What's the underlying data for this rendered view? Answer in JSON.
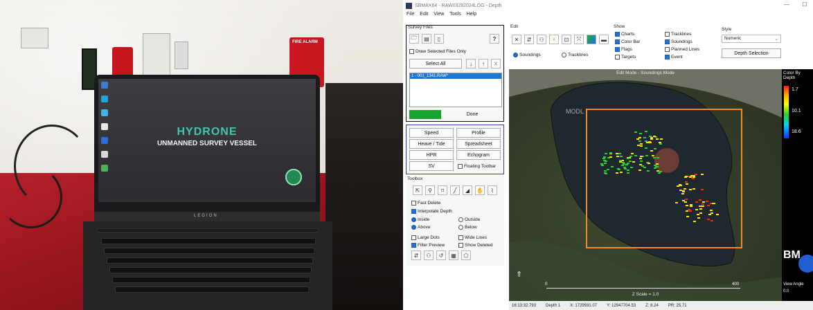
{
  "photo": {
    "screen_title": "HYDRONE",
    "screen_subtitle": "UNMANNED SURVEY VESSEL",
    "brand": "LEGION",
    "alarm_text": "FIRE ALARM"
  },
  "window": {
    "title": "SBMAX64 - RAW03282024LOG - Depth",
    "minimize": "—",
    "maximize": "☐"
  },
  "menu": [
    "File",
    "Edit",
    "View",
    "Tools",
    "Help"
  ],
  "survey_files": {
    "title": "Survey Files",
    "help": "?",
    "draw_selected_label": "Draw Selected Files Only",
    "select_all": "Select All",
    "file_item": "1 - 001_1341.RAW*",
    "done": "Done"
  },
  "modules": {
    "speed": "Speed",
    "profile": "Profile",
    "heave_tide": "Heave / Tide",
    "spreadsheet": "Spreadsheet",
    "hpr": "HPR",
    "echogram": "Echogram",
    "sv": "SV",
    "floating_toolbar": "Floating Toolbar"
  },
  "toolbox": {
    "title": "Toolbox",
    "fast_delete": "Fast Delete",
    "interpolate_depth": "Interpolate Depth",
    "inside": "Inside",
    "outside": "Outside",
    "above": "Above",
    "below": "Below",
    "large_dots": "Large Dots",
    "wide_lines": "Wide Lines",
    "filter_preview": "Filter Preview",
    "show_deleted": "Show Deleted"
  },
  "edit_group": {
    "title": "Edit",
    "soundings": "Soundings",
    "tracklines": "Tracklines"
  },
  "show_group": {
    "title": "Show",
    "charts": "Charts",
    "color_bar": "Color Bar",
    "flags": "Flags",
    "targets": "Targets",
    "tracklines": "Tracklines",
    "soundings": "Soundings",
    "planned_lines": "Planned Lines",
    "event": "Event"
  },
  "style_group": {
    "title": "Style",
    "selected": "Numeric",
    "depth_selection": "Depth Selection"
  },
  "map": {
    "mode_label": "Edit Mode - Soundings Mode",
    "z_scale": "Z Scale = 1.0",
    "scale_left": "0",
    "scale_right": "400",
    "corner_text": "BM",
    "view_angle": "View Angle",
    "view_angle_value": "0.0",
    "colors": {
      "high": "#ff2a00",
      "mid": "#ffe600",
      "low": "#2bd12b",
      "route": "#f08a2a"
    }
  },
  "colorbar": {
    "title": "Color By Depth",
    "top": "1.7",
    "mid": "10.1",
    "bottom": "18.6"
  },
  "status": [
    "16:13:32.793",
    "Depth 1",
    "X: 1729591.07",
    "Y: 12947704.53",
    "Z: 8.24",
    "PR: 25.71"
  ]
}
